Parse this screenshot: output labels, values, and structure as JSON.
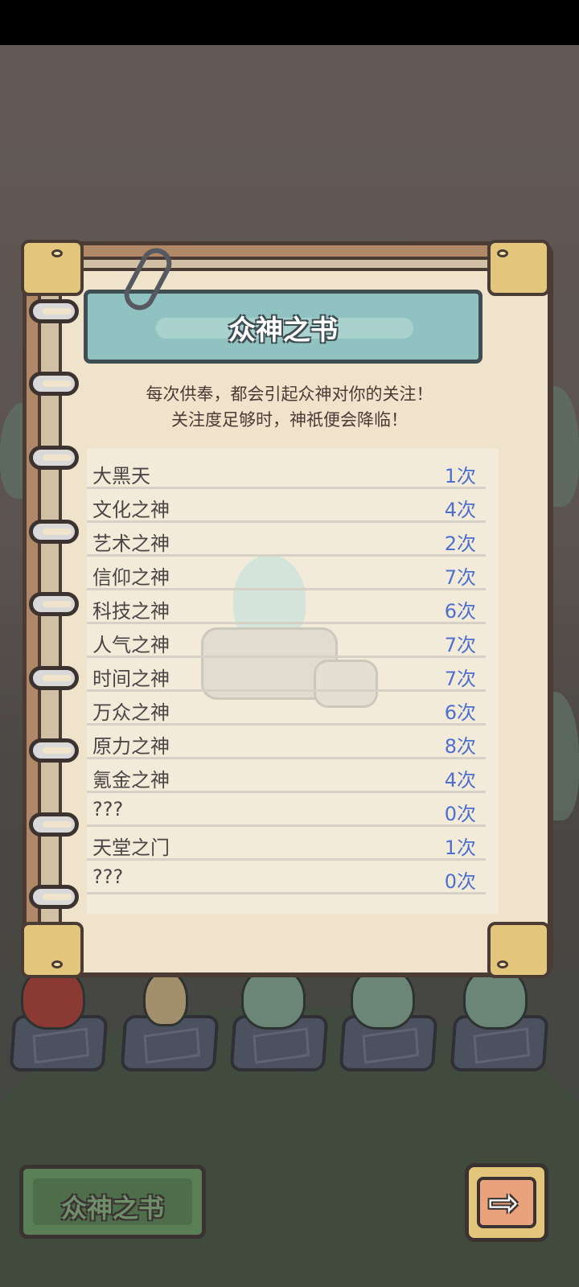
{
  "book": {
    "title": "众神之书",
    "description_line1": "每次供奉，都会引起众神对你的关注！",
    "description_line2": "关注度足够时，神祇便会降临！",
    "gods": [
      {
        "name": "大黑天",
        "count": "1次"
      },
      {
        "name": "文化之神",
        "count": "4次"
      },
      {
        "name": "艺术之神",
        "count": "2次"
      },
      {
        "name": "信仰之神",
        "count": "7次"
      },
      {
        "name": "科技之神",
        "count": "6次"
      },
      {
        "name": "人气之神",
        "count": "7次"
      },
      {
        "name": "时间之神",
        "count": "7次"
      },
      {
        "name": "万众之神",
        "count": "6次"
      },
      {
        "name": "原力之神",
        "count": "8次"
      },
      {
        "name": "氪金之神",
        "count": "4次"
      },
      {
        "name": "???",
        "count": "0次"
      },
      {
        "name": "天堂之门",
        "count": "1次"
      },
      {
        "name": "???",
        "count": "0次"
      }
    ]
  },
  "bottom": {
    "book_button_label": "众神之书",
    "next_icon": "arrow-right-icon"
  },
  "colors": {
    "count_text": "#4f6fcf",
    "banner": "#8fc2c0",
    "page": "#efe3cc"
  }
}
